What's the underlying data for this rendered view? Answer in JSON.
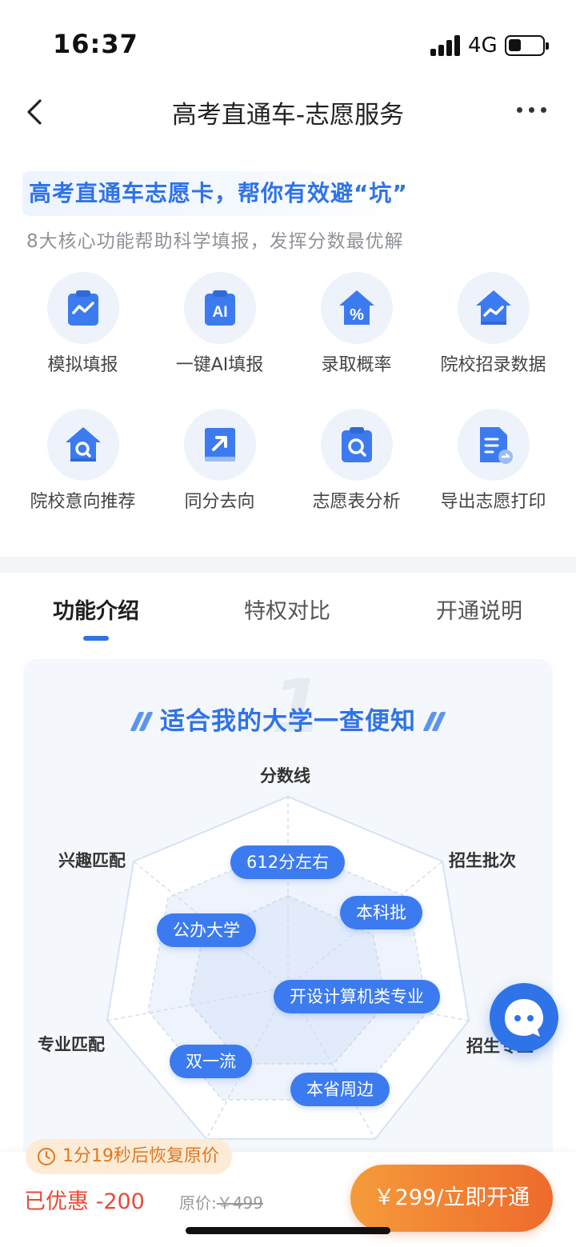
{
  "status_bar": {
    "time": "16:37",
    "network": "4G"
  },
  "nav": {
    "title": "高考直通车-志愿服务"
  },
  "hero": {
    "title": "高考直通车志愿卡，帮你有效避“坑”",
    "subtitle": "8大核心功能帮助科学填报，发挥分数最优解"
  },
  "features": [
    {
      "label": "模拟填报",
      "icon": "chart-clipboard-icon"
    },
    {
      "label": "一键AI填报",
      "icon": "ai-clipboard-icon"
    },
    {
      "label": "录取概率",
      "icon": "percent-house-icon"
    },
    {
      "label": "院校招录数据",
      "icon": "chart-house-icon"
    },
    {
      "label": "院校意向推荐",
      "icon": "search-house-icon"
    },
    {
      "label": "同分去向",
      "icon": "arrow-book-icon"
    },
    {
      "label": "志愿表分析",
      "icon": "search-clipboard-icon"
    },
    {
      "label": "导出志愿打印",
      "icon": "export-document-icon"
    }
  ],
  "tabs": [
    {
      "label": "功能介绍",
      "active": true
    },
    {
      "label": "特权对比",
      "active": false
    },
    {
      "label": "开通说明",
      "active": false
    }
  ],
  "card": {
    "number": "1",
    "title": "适合我的大学一查便知",
    "axes": [
      "分数线",
      "招生批次",
      "招生专业",
      "专业匹配",
      "兴趣匹配"
    ],
    "tags": [
      "612分左右",
      "本科批",
      "公办大学",
      "开设计算机类专业",
      "双一流",
      "本省周边"
    ]
  },
  "bottom": {
    "countdown": "1分19秒后恢复原价",
    "discount": "已优惠 -200",
    "original_label": "原价:",
    "original_price": "￥499",
    "buy_label": "￥299/立即开通"
  },
  "colors": {
    "primary": "#2f73e8",
    "accent": "#ee6a2c",
    "discount": "#e84a35"
  }
}
